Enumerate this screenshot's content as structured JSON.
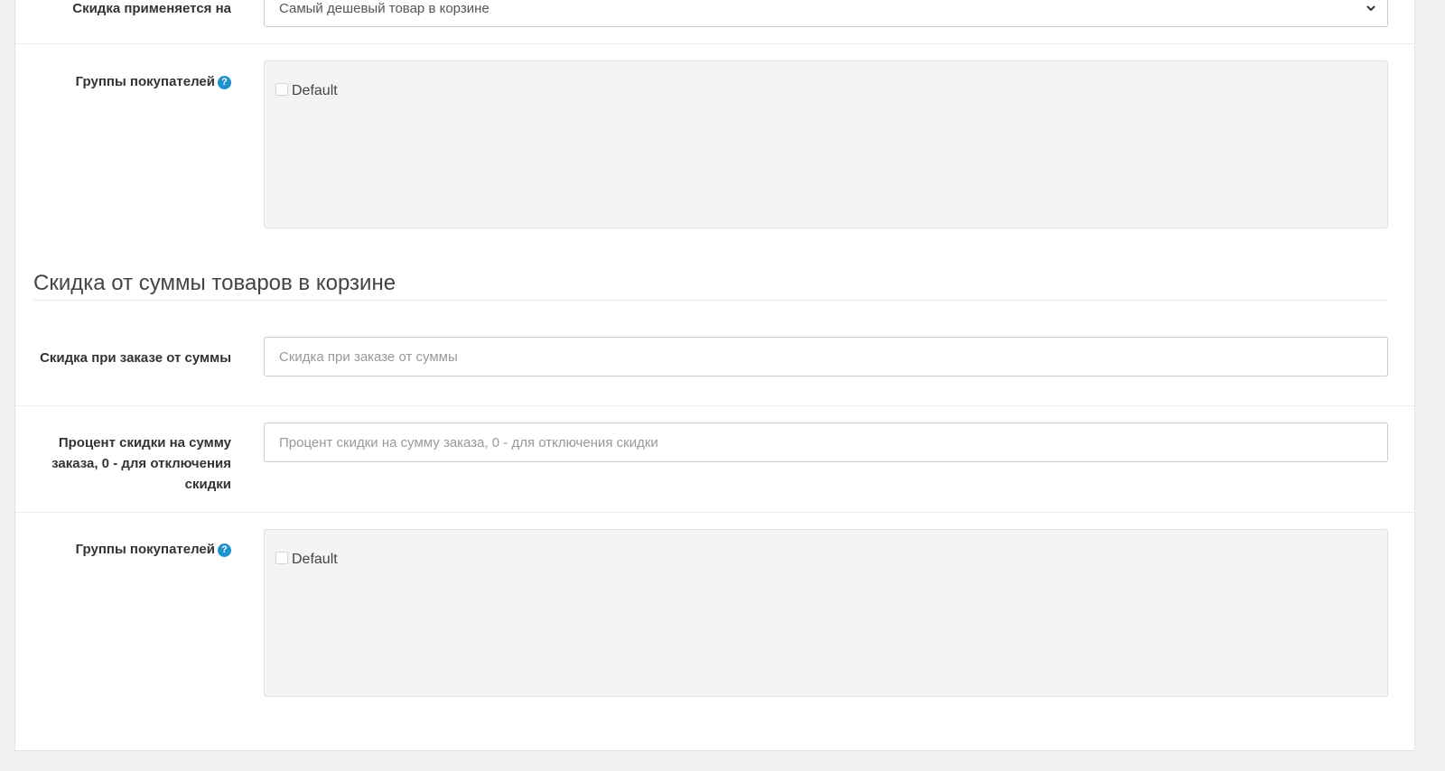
{
  "discount_applies": {
    "label": "Скидка применяется на",
    "selected_value": "Самый дешевый товар в корзине"
  },
  "customer_groups_1": {
    "label": "Группы покупателей",
    "options": [
      {
        "label": "Default",
        "checked": false
      }
    ]
  },
  "cart_sum_section": {
    "title": "Скидка от суммы товаров в корзине"
  },
  "min_order_sum": {
    "label": "Скидка при заказе от суммы",
    "placeholder": "Скидка при заказе от суммы",
    "value": ""
  },
  "discount_percent": {
    "label": "Процент скидки на сумму заказа, 0 - для отключения скидки",
    "placeholder": "Процент скидки на сумму заказа, 0 - для отключения скидки",
    "value": ""
  },
  "customer_groups_2": {
    "label": "Группы покупателей",
    "options": [
      {
        "label": "Default",
        "checked": false
      }
    ]
  },
  "icons": {
    "help": "question-circle-icon",
    "select": "chevron-down-icon"
  },
  "colors": {
    "help_icon": "#1e91cf",
    "well_background": "#f4f4f4",
    "page_background": "#f0f0f0"
  }
}
